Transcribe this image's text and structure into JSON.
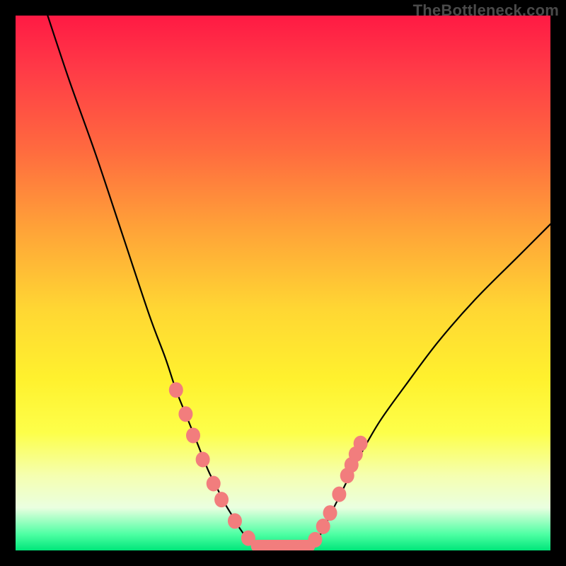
{
  "watermark": "TheBottleneck.com",
  "chart_data": {
    "type": "line",
    "title": "",
    "xlabel": "",
    "ylabel": "",
    "xlim": [
      0,
      100
    ],
    "ylim": [
      0,
      100
    ],
    "series": [
      {
        "name": "left-branch",
        "x": [
          6,
          10,
          15,
          20,
          25,
          28,
          30,
          32,
          34,
          36,
          37.5,
          39,
          40.5,
          42,
          43.5,
          45
        ],
        "y": [
          100,
          88,
          74,
          59,
          44,
          36,
          30,
          25,
          20,
          15,
          12,
          9,
          6.5,
          4,
          2,
          0.5
        ]
      },
      {
        "name": "floor",
        "x": [
          45,
          55
        ],
        "y": [
          0.5,
          0.5
        ]
      },
      {
        "name": "right-branch",
        "x": [
          55,
          57,
          59,
          61,
          64,
          68,
          73,
          79,
          86,
          94,
          100
        ],
        "y": [
          0.5,
          3,
          7,
          11,
          17,
          24,
          31,
          39,
          47,
          55,
          61
        ]
      }
    ],
    "markers_left": [
      {
        "x": 30.0,
        "y": 30.0
      },
      {
        "x": 31.8,
        "y": 25.5
      },
      {
        "x": 33.2,
        "y": 21.5
      },
      {
        "x": 35.0,
        "y": 17.0
      },
      {
        "x": 37.0,
        "y": 12.5
      },
      {
        "x": 38.5,
        "y": 9.5
      },
      {
        "x": 41.0,
        "y": 5.5
      },
      {
        "x": 43.5,
        "y": 2.3
      }
    ],
    "markers_right": [
      {
        "x": 56.0,
        "y": 2.0
      },
      {
        "x": 57.5,
        "y": 4.5
      },
      {
        "x": 58.8,
        "y": 7.0
      },
      {
        "x": 60.5,
        "y": 10.5
      },
      {
        "x": 62.0,
        "y": 14.0
      },
      {
        "x": 62.8,
        "y": 16.0
      },
      {
        "x": 63.6,
        "y": 18.0
      },
      {
        "x": 64.5,
        "y": 20.0
      }
    ],
    "floor_pill": {
      "x1": 44,
      "x2": 56,
      "y": 0.8
    }
  }
}
